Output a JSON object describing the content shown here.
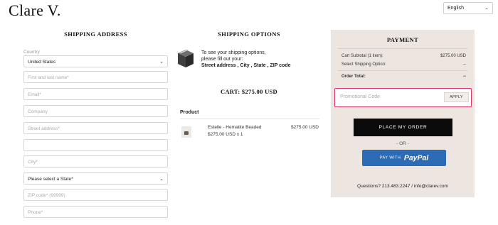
{
  "brand": {
    "logo": "Clare V."
  },
  "language": {
    "selected": "English"
  },
  "shipping_address": {
    "title": "SHIPPING ADDRESS",
    "country_label": "Country",
    "country_value": "United States",
    "fields": {
      "name": "First and last name*",
      "email": "Email*",
      "company": "Company",
      "street": "Street address*",
      "street2": "",
      "city": "City*",
      "state": "Please select a State*",
      "zip": "ZIP code* (99999)",
      "phone": "Phone*"
    }
  },
  "shipping_options": {
    "title": "SHIPPING OPTIONS",
    "message_line1": "To see your shipping options,",
    "message_line2": "please fill out your:",
    "message_required": "Street address , City , State , ZIP code",
    "cart_total": "CART:  $275.00 USD",
    "product_header": "Product",
    "product": {
      "name": "Estelle - Hematite Beaded",
      "detail": "$275.00 USD x 1",
      "price": "$275.00 USD"
    }
  },
  "payment": {
    "title": "PAYMENT",
    "subtotal_label": "Cart Subtotal (1 item):",
    "subtotal_value": "$275.00 USD",
    "shipping_label": "Select Shipping Option:",
    "shipping_value": "--",
    "total_label": "Order Total:",
    "total_value": "--",
    "promo_placeholder": "Promotional Code",
    "promo_button": "APPLY",
    "place_order": "PLACE MY ORDER",
    "or_text": "- OR -",
    "paypal_with": "PAY WITH",
    "paypal_brand": "PayPal",
    "contact": "Questions? 213.483.2247 / info@clarev.com",
    "accent_color": "#d8346b",
    "paypal_color": "#2c6bb6",
    "panel_color": "#ede6e0"
  }
}
